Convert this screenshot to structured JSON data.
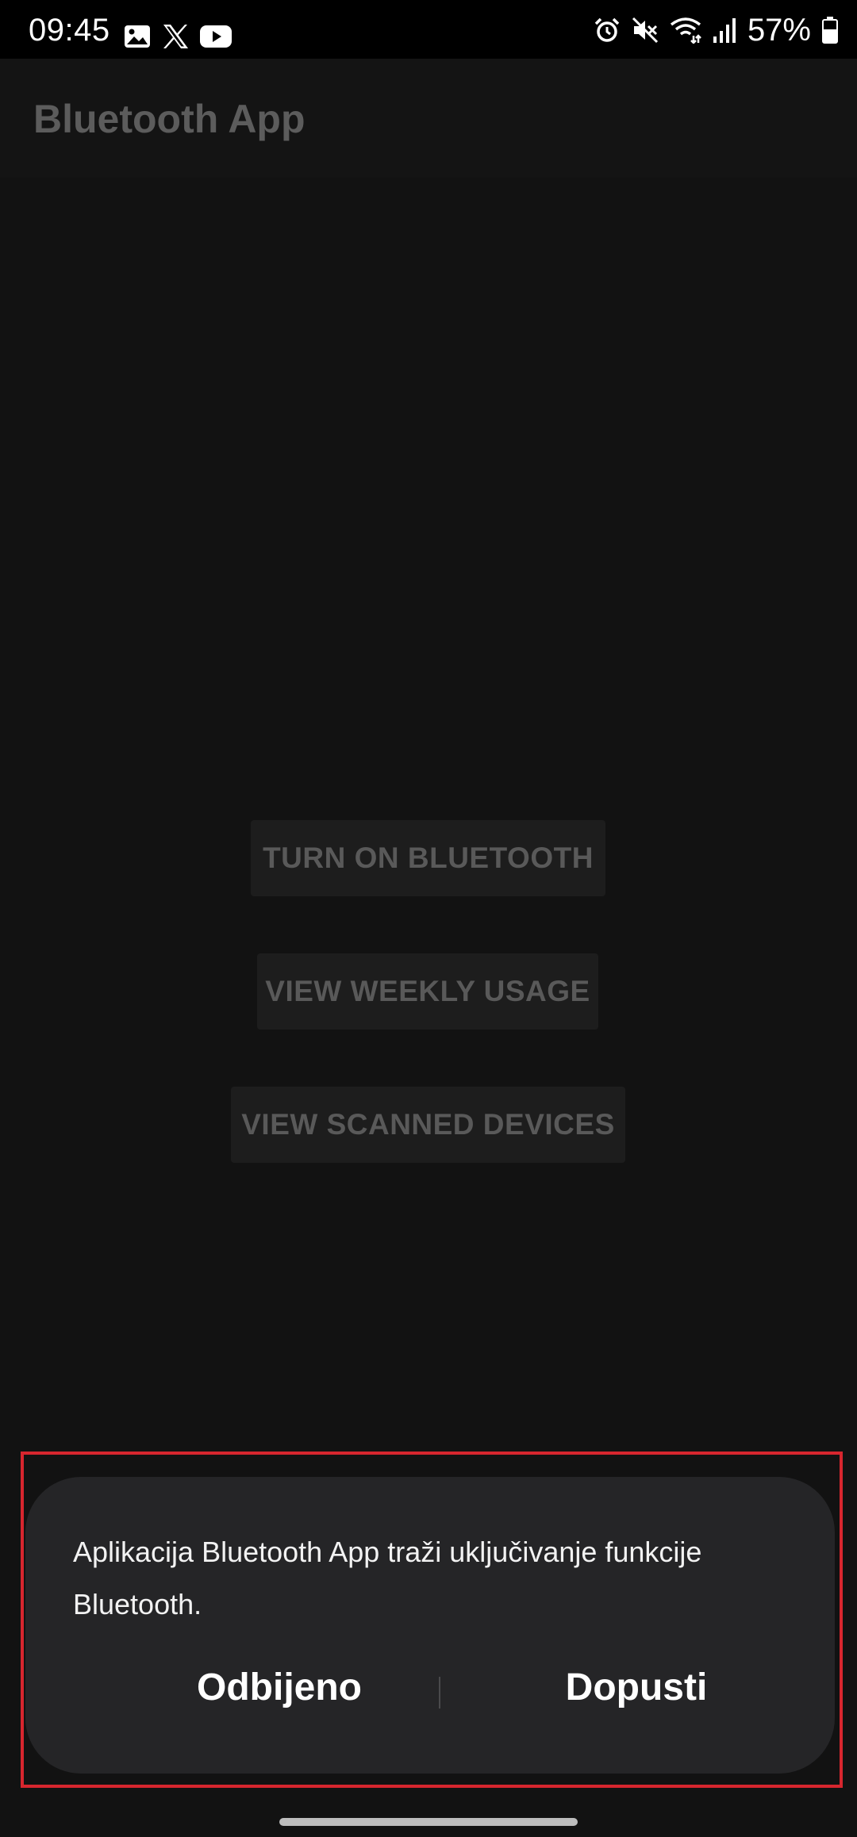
{
  "status_bar": {
    "time": "09:45",
    "battery": "57%",
    "left_icons": [
      "gallery-icon",
      "x-icon",
      "youtube-icon"
    ],
    "right_icons": [
      "alarm-icon",
      "mute-icon",
      "wifi-icon",
      "signal-icon",
      "battery-icon"
    ]
  },
  "app_bar": {
    "title": "Bluetooth App"
  },
  "buttons": {
    "turn_on": "TURN ON BLUETOOTH",
    "weekly_usage": "VIEW WEEKLY USAGE",
    "scanned_devices": "VIEW SCANNED DEVICES"
  },
  "dialog": {
    "message": "Aplikacija Bluetooth App traži uključivanje funkcije Bluetooth.",
    "deny_label": "Odbijeno",
    "allow_label": "Dopusti"
  },
  "colors": {
    "background": "#121212",
    "dialog": "#252527",
    "highlight": "#d7262e"
  }
}
